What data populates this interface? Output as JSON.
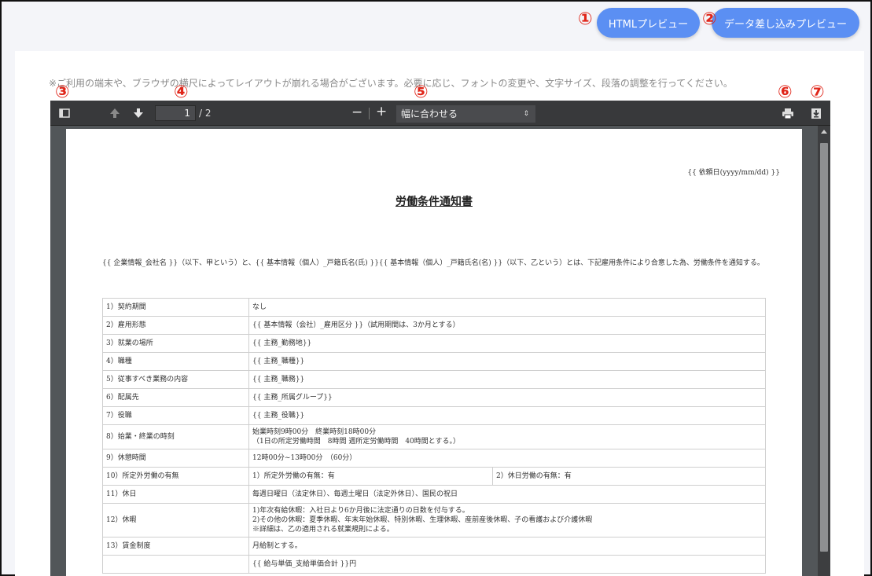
{
  "top_buttons": {
    "html_preview": "HTMLプレビュー",
    "merge_preview": "データ差し込みプレビュー"
  },
  "markers": [
    "①",
    "②",
    "③",
    "④",
    "⑤",
    "⑥",
    "⑦"
  ],
  "notice": "※ご利用の端末や、ブラウザの横尺によってレイアウトが崩れる場合がございます。必要に応じ、フォントの変更や、文字サイズ、段落の調整を行ってください。",
  "toolbar": {
    "page_current": "1",
    "page_total": "/ 2",
    "zoom_label": "幅に合わせる",
    "zoom_arrow": "⇕",
    "minus": "−",
    "plus": "+"
  },
  "document": {
    "date": "{{ 依頼日(yyyy/mm/dd) }}",
    "title": "労働条件通知書",
    "intro": "{{ 企業情報_会社名 }}（以下、甲という）と、{{ 基本情報（個人）_戸籍氏名(氏) }}{{ 基本情報（個人）_戸籍氏名(名) }}（以下、乙という）とは、下記雇用条件により合意した為、労働条件を通知する。",
    "rows": [
      {
        "label": "1）契約期間",
        "value": "なし"
      },
      {
        "label": "2）雇用形態",
        "value": "{{ 基本情報（会社）_雇用区分 }}（試用期間は、3か月とする）"
      },
      {
        "label": "3）就業の場所",
        "value": "{{ 主務_勤務地}}"
      },
      {
        "label": "4）職種",
        "value": "{{ 主務_職種}}"
      },
      {
        "label": "5）従事すべき業務の内容",
        "value": "{{ 主務_職務}}"
      },
      {
        "label": "6）配属先",
        "value": "{{ 主務_所属グループ}}"
      },
      {
        "label": "7）役職",
        "value": "{{ 主務_役職}}"
      },
      {
        "label": "8）始業・終業の時刻",
        "value": "始業時刻9時00分　終業時刻18時00分",
        "value2": "（1日の所定労働時間　8時間 週所定労働時間　40時間とする。）"
      },
      {
        "label": "9）休憩時間",
        "value": "12時00分~13時00分　（60分）"
      },
      {
        "label": "10）所定外労働の有無",
        "value": "1）所定外労働の有無：有",
        "value_extra": "2）休日労働の有無：有"
      },
      {
        "label": "11）休日",
        "value": "毎週日曜日（法定休日）、毎週土曜日（法定外休日）、国民の祝日"
      },
      {
        "label": "12）休暇",
        "value": "1)年次有給休暇：入社日より6か月後に法定通りの日数を付与する。",
        "value2": "2)その他の休暇：夏季休暇、年末年始休暇、特別休暇、生理休暇、産前産後休暇、子の看護および介護休暇",
        "value3": "※詳細は、乙の適用される就業規則による。"
      },
      {
        "label": "13）賃金制度",
        "value": "月給制とする。"
      },
      {
        "label": "",
        "value": "{{ 給与単価_支給単価合計 }}円"
      }
    ]
  },
  "colors": {
    "accent": "#5b8ff3",
    "marker": "#e0261a",
    "toolbar": "#38393b",
    "viewer_bg": "#525659"
  }
}
